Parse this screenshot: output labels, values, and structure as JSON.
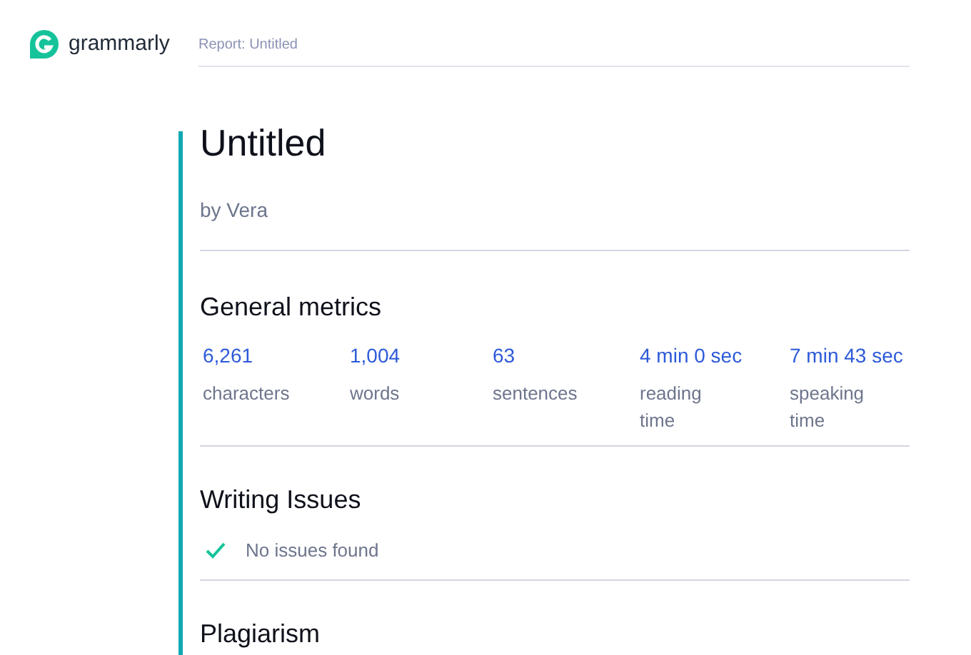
{
  "header": {
    "brand": "grammarly",
    "breadcrumb": "Report: Untitled"
  },
  "document": {
    "title": "Untitled",
    "author": "by Vera"
  },
  "general_metrics": {
    "heading": "General metrics",
    "metrics": [
      {
        "value": "6,261",
        "label": "characters"
      },
      {
        "value": "1,004",
        "label": "words"
      },
      {
        "value": "63",
        "label": "sentences"
      },
      {
        "value": "4 min 0 sec",
        "label": "reading time"
      },
      {
        "value": "7 min 43 sec",
        "label": "speaking time"
      }
    ]
  },
  "writing_issues": {
    "heading": "Writing Issues",
    "status": "No issues found"
  },
  "plagiarism": {
    "heading": "Plagiarism"
  }
}
